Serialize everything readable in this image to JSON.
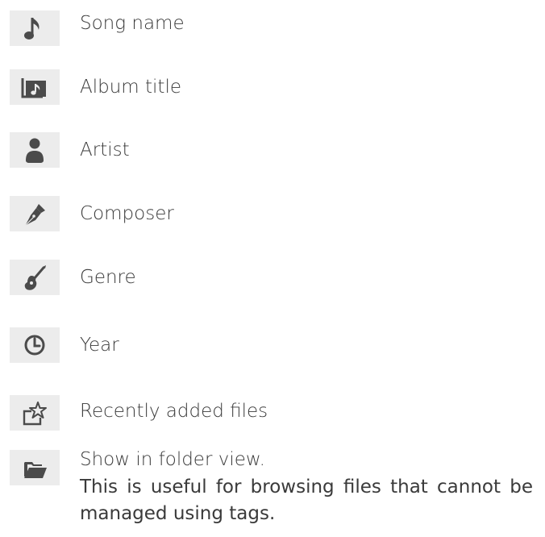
{
  "items": [
    {
      "icon": "music-note-icon",
      "label": "Song name"
    },
    {
      "icon": "album-icon",
      "label": "Album title"
    },
    {
      "icon": "person-icon",
      "label": "Artist"
    },
    {
      "icon": "pen-nib-icon",
      "label": "Composer"
    },
    {
      "icon": "guitar-icon",
      "label": "Genre"
    },
    {
      "icon": "clock-icon",
      "label": "Year"
    },
    {
      "icon": "star-tray-icon",
      "label": "Recently added files"
    },
    {
      "icon": "folder-icon",
      "label": "Show in folder view."
    }
  ],
  "folder_description": {
    "line1": "This is useful for browsing files that cannot be",
    "line2": "managed using tags."
  },
  "colors": {
    "icon_tile": "#ececec",
    "icon_glyph": "#4b4b4b",
    "text": "#3a3a3a"
  }
}
